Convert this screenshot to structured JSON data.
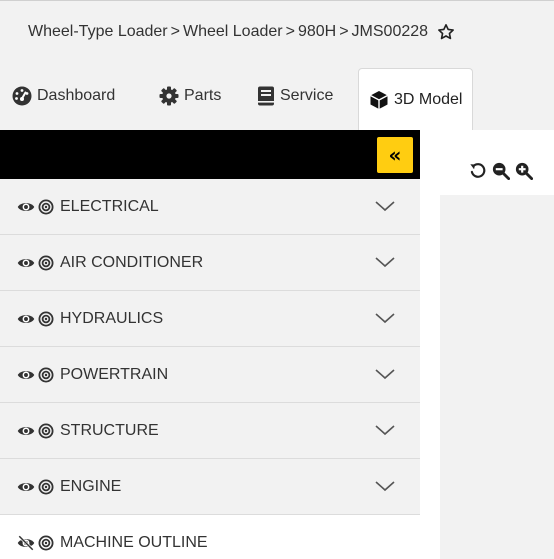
{
  "breadcrumb": {
    "items": [
      "Wheel-Type Loader",
      "Wheel Loader",
      "980H",
      "JMS00228"
    ],
    "separator": ">"
  },
  "tabs": [
    {
      "label": "Dashboard",
      "icon": "dashboard-icon"
    },
    {
      "label": "Parts",
      "icon": "gear-icon"
    },
    {
      "label": "Service",
      "icon": "book-icon"
    },
    {
      "label": "3D Model",
      "icon": "cube-icon",
      "active": true
    }
  ],
  "panel": {
    "collapse_label": "«",
    "systems": [
      {
        "label": "ELECTRICAL",
        "visible": true
      },
      {
        "label": "AIR CONDITIONER",
        "visible": true
      },
      {
        "label": "HYDRAULICS",
        "visible": true
      },
      {
        "label": "POWERTRAIN",
        "visible": true
      },
      {
        "label": "STRUCTURE",
        "visible": true
      },
      {
        "label": "ENGINE",
        "visible": true
      },
      {
        "label": "MACHINE OUTLINE",
        "visible": false
      }
    ]
  },
  "viewer": {
    "tools": [
      "reset-icon",
      "zoom-out-icon",
      "zoom-in-icon"
    ]
  },
  "colors": {
    "accent": "#ffcd11",
    "panel_header": "#000000",
    "row_background": "#f2f2f2",
    "text": "#333333"
  }
}
